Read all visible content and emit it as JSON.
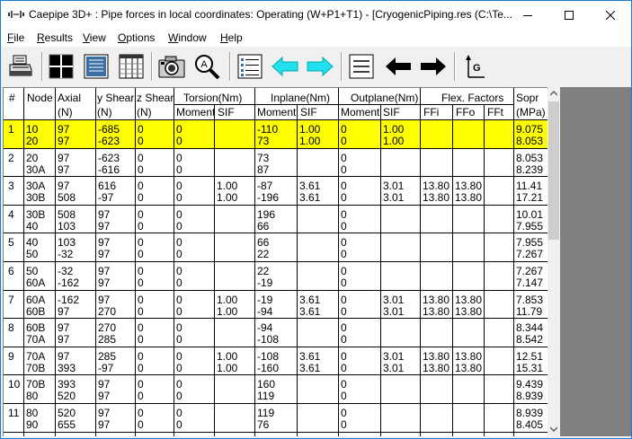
{
  "window": {
    "title": "Caepipe 3D+ : Pipe forces in local coordinates: Operating (W+P1+T1) -  [CryogenicPiping.res (C:\\Te...",
    "border_color": "#1a7fd4"
  },
  "menu": [
    {
      "label": "File",
      "ul": "F",
      "rest": "ile"
    },
    {
      "label": "Results",
      "ul": "R",
      "rest": "esults"
    },
    {
      "label": "View",
      "ul": "V",
      "rest": "iew"
    },
    {
      "label": "Options",
      "ul": "O",
      "rest": "ptions"
    },
    {
      "label": "Window",
      "ul": "W",
      "rest": "indow"
    },
    {
      "label": "Help",
      "ul": "H",
      "rest": "elp"
    }
  ],
  "toolbar": [
    {
      "icon": "printer-icon"
    },
    {
      "icon": "grid-view-icon"
    },
    {
      "icon": "text-view-icon"
    },
    {
      "icon": "table-view-icon"
    },
    {
      "icon": "camera-icon"
    },
    {
      "icon": "zoom-icon"
    },
    {
      "icon": "list-icon"
    },
    {
      "icon": "arrow-left-cyan-icon"
    },
    {
      "icon": "arrow-right-cyan-icon"
    },
    {
      "icon": "lines-icon"
    },
    {
      "icon": "arrow-left-black-icon"
    },
    {
      "icon": "arrow-right-black-icon"
    },
    {
      "icon": "gravity-axis-icon",
      "label": "G"
    }
  ],
  "table": {
    "headers": {
      "num": "#",
      "node": "Node",
      "axial": "Axial",
      "axial_unit": "(N)",
      "yshear": "y Shear",
      "yshear_unit": "(N)",
      "zshear": "z Shear",
      "zshear_unit": "(N)",
      "torsion": "Torsion(Nm)",
      "inplane": "Inplane(Nm)",
      "outplane": "Outplane(Nm)",
      "flex": "Flex. Factors",
      "sopr": "Sopr",
      "sopr_unit": "(MPa)",
      "moment": "Moment",
      "sif": "SIF",
      "ffi": "FFi",
      "ffo": "FFo",
      "fft": "FFt"
    },
    "highlight_color": "#ffff00",
    "rows": [
      {
        "num": "1",
        "node": [
          "10",
          "20"
        ],
        "axial": [
          "97",
          "97"
        ],
        "yshear": [
          "-685",
          "-623"
        ],
        "zshear": [
          "0",
          "0"
        ],
        "tor_m": [
          "0",
          "0"
        ],
        "tor_sif": [
          "",
          ""
        ],
        "in_m": [
          "-110",
          "73"
        ],
        "in_sif": [
          "1.00",
          "1.00"
        ],
        "out_m": [
          "0",
          "0"
        ],
        "out_sif": [
          "1.00",
          "1.00"
        ],
        "ffi": [
          "",
          ""
        ],
        "ffo": [
          "",
          ""
        ],
        "fft": [
          "",
          ""
        ],
        "sopr": [
          "9.075",
          "8.053"
        ],
        "highlight": true
      },
      {
        "num": "2",
        "node": [
          "20",
          "30A"
        ],
        "axial": [
          "97",
          "97"
        ],
        "yshear": [
          "-623",
          "-616"
        ],
        "zshear": [
          "0",
          "0"
        ],
        "tor_m": [
          "0",
          "0"
        ],
        "tor_sif": [
          "",
          ""
        ],
        "in_m": [
          "73",
          "87"
        ],
        "in_sif": [
          "",
          ""
        ],
        "out_m": [
          "0",
          "0"
        ],
        "out_sif": [
          "",
          ""
        ],
        "ffi": [
          "",
          ""
        ],
        "ffo": [
          "",
          ""
        ],
        "fft": [
          "",
          ""
        ],
        "sopr": [
          "8.053",
          "8.239"
        ]
      },
      {
        "num": "3",
        "node": [
          "30A",
          "30B"
        ],
        "axial": [
          "97",
          "508"
        ],
        "yshear": [
          "616",
          "-97"
        ],
        "zshear": [
          "0",
          "0"
        ],
        "tor_m": [
          "0",
          "0"
        ],
        "tor_sif": [
          "1.00",
          "1.00"
        ],
        "in_m": [
          "-87",
          "-196"
        ],
        "in_sif": [
          "3.61",
          "3.61"
        ],
        "out_m": [
          "0",
          "0"
        ],
        "out_sif": [
          "3.01",
          "3.01"
        ],
        "ffi": [
          "13.80",
          "13.80"
        ],
        "ffo": [
          "13.80",
          "13.80"
        ],
        "fft": [
          "",
          ""
        ],
        "sopr": [
          "11.41",
          "17.21"
        ]
      },
      {
        "num": "4",
        "node": [
          "30B",
          "40"
        ],
        "axial": [
          "508",
          "103"
        ],
        "yshear": [
          "97",
          "97"
        ],
        "zshear": [
          "0",
          "0"
        ],
        "tor_m": [
          "0",
          "0"
        ],
        "tor_sif": [
          "",
          ""
        ],
        "in_m": [
          "196",
          "66"
        ],
        "in_sif": [
          "",
          ""
        ],
        "out_m": [
          "0",
          "0"
        ],
        "out_sif": [
          "",
          ""
        ],
        "ffi": [
          "",
          ""
        ],
        "ffo": [
          "",
          ""
        ],
        "fft": [
          "",
          ""
        ],
        "sopr": [
          "10.01",
          "7.955"
        ]
      },
      {
        "num": "5",
        "node": [
          "40",
          "50"
        ],
        "axial": [
          "103",
          "-32"
        ],
        "yshear": [
          "97",
          "97"
        ],
        "zshear": [
          "0",
          "0"
        ],
        "tor_m": [
          "0",
          "0"
        ],
        "tor_sif": [
          "",
          ""
        ],
        "in_m": [
          "66",
          "22"
        ],
        "in_sif": [
          "",
          ""
        ],
        "out_m": [
          "0",
          "0"
        ],
        "out_sif": [
          "",
          ""
        ],
        "ffi": [
          "",
          ""
        ],
        "ffo": [
          "",
          ""
        ],
        "fft": [
          "",
          ""
        ],
        "sopr": [
          "7.955",
          "7.267"
        ]
      },
      {
        "num": "6",
        "node": [
          "50",
          "60A"
        ],
        "axial": [
          "-32",
          "-162"
        ],
        "yshear": [
          "97",
          "97"
        ],
        "zshear": [
          "0",
          "0"
        ],
        "tor_m": [
          "0",
          "0"
        ],
        "tor_sif": [
          "",
          ""
        ],
        "in_m": [
          "22",
          "-19"
        ],
        "in_sif": [
          "",
          ""
        ],
        "out_m": [
          "0",
          "0"
        ],
        "out_sif": [
          "",
          ""
        ],
        "ffi": [
          "",
          ""
        ],
        "ffo": [
          "",
          ""
        ],
        "fft": [
          "",
          ""
        ],
        "sopr": [
          "7.267",
          "7.147"
        ]
      },
      {
        "num": "7",
        "node": [
          "60A",
          "60B"
        ],
        "axial": [
          "-162",
          "97"
        ],
        "yshear": [
          "97",
          "270"
        ],
        "zshear": [
          "0",
          "0"
        ],
        "tor_m": [
          "0",
          "0"
        ],
        "tor_sif": [
          "1.00",
          "1.00"
        ],
        "in_m": [
          "-19",
          "-94"
        ],
        "in_sif": [
          "3.61",
          "3.61"
        ],
        "out_m": [
          "0",
          "0"
        ],
        "out_sif": [
          "3.01",
          "3.01"
        ],
        "ffi": [
          "13.80",
          "13.80"
        ],
        "ffo": [
          "13.80",
          "13.80"
        ],
        "fft": [
          "",
          ""
        ],
        "sopr": [
          "7.853",
          "11.79"
        ]
      },
      {
        "num": "8",
        "node": [
          "60B",
          "70A"
        ],
        "axial": [
          "97",
          "97"
        ],
        "yshear": [
          "270",
          "285"
        ],
        "zshear": [
          "0",
          "0"
        ],
        "tor_m": [
          "0",
          "0"
        ],
        "tor_sif": [
          "",
          ""
        ],
        "in_m": [
          "-94",
          "-108"
        ],
        "in_sif": [
          "",
          ""
        ],
        "out_m": [
          "0",
          "0"
        ],
        "out_sif": [
          "",
          ""
        ],
        "ffi": [
          "",
          ""
        ],
        "ffo": [
          "",
          ""
        ],
        "fft": [
          "",
          ""
        ],
        "sopr": [
          "8.344",
          "8.542"
        ]
      },
      {
        "num": "9",
        "node": [
          "70A",
          "70B"
        ],
        "axial": [
          "97",
          "393"
        ],
        "yshear": [
          "285",
          "-97"
        ],
        "zshear": [
          "0",
          "0"
        ],
        "tor_m": [
          "0",
          "0"
        ],
        "tor_sif": [
          "1.00",
          "1.00"
        ],
        "in_m": [
          "-108",
          "-160"
        ],
        "in_sif": [
          "3.61",
          "3.61"
        ],
        "out_m": [
          "0",
          "0"
        ],
        "out_sif": [
          "3.01",
          "3.01"
        ],
        "ffi": [
          "13.80",
          "13.80"
        ],
        "ffo": [
          "13.80",
          "13.80"
        ],
        "fft": [
          "",
          ""
        ],
        "sopr": [
          "12.51",
          "15.31"
        ]
      },
      {
        "num": "10",
        "node": [
          "70B",
          "80"
        ],
        "axial": [
          "393",
          "520"
        ],
        "yshear": [
          "97",
          "97"
        ],
        "zshear": [
          "0",
          "0"
        ],
        "tor_m": [
          "0",
          "0"
        ],
        "tor_sif": [
          "",
          ""
        ],
        "in_m": [
          "160",
          "119"
        ],
        "in_sif": [
          "",
          ""
        ],
        "out_m": [
          "0",
          "0"
        ],
        "out_sif": [
          "",
          ""
        ],
        "ffi": [
          "",
          ""
        ],
        "ffo": [
          "",
          ""
        ],
        "fft": [
          "",
          ""
        ],
        "sopr": [
          "9.439",
          "8.939"
        ]
      },
      {
        "num": "11",
        "node": [
          "80",
          "90"
        ],
        "axial": [
          "520",
          "655"
        ],
        "yshear": [
          "97",
          "97"
        ],
        "zshear": [
          "0",
          "0"
        ],
        "tor_m": [
          "0",
          "0"
        ],
        "tor_sif": [
          "",
          ""
        ],
        "in_m": [
          "119",
          "76"
        ],
        "in_sif": [
          "",
          ""
        ],
        "out_m": [
          "0",
          "0"
        ],
        "out_sif": [
          "",
          ""
        ],
        "ffi": [
          "",
          ""
        ],
        "ffo": [
          "",
          ""
        ],
        "fft": [
          "",
          ""
        ],
        "sopr": [
          "8.939",
          "8.405"
        ]
      }
    ]
  }
}
